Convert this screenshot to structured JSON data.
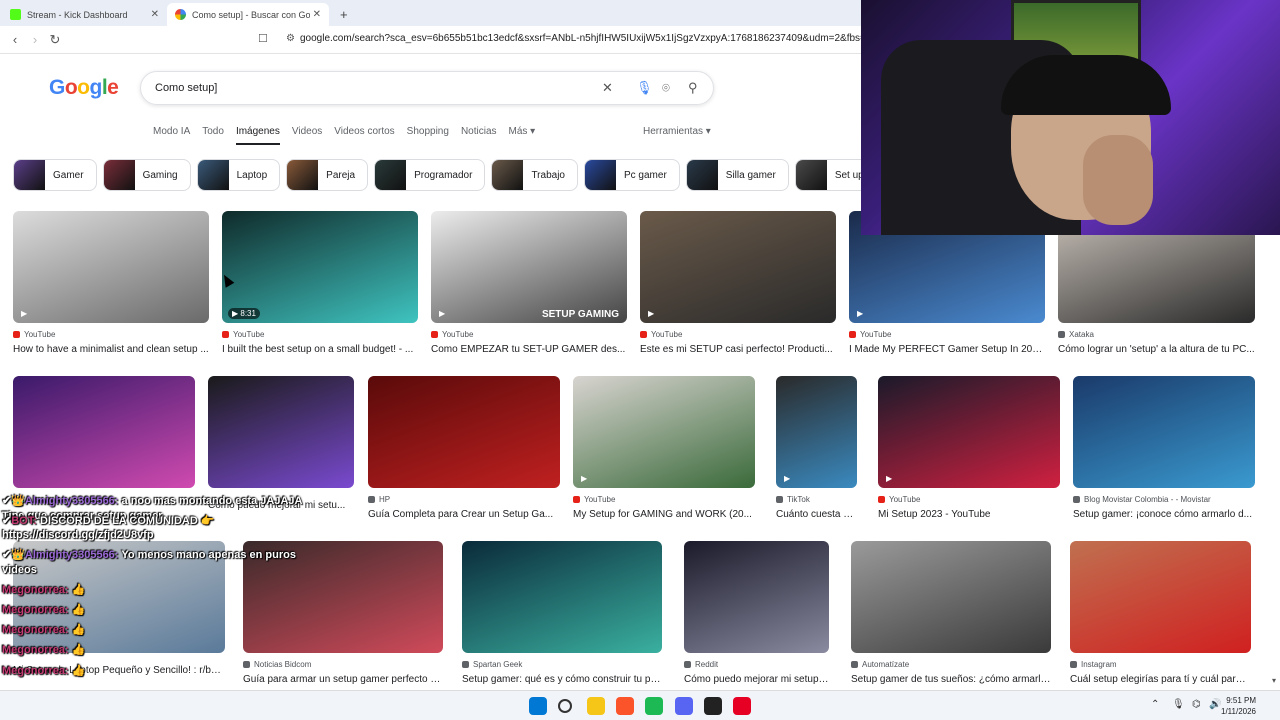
{
  "browser": {
    "tabs": [
      {
        "title": "Stream - Kick Dashboard"
      },
      {
        "title": "Como setup] - Buscar con Goog"
      }
    ],
    "new_tab": "+",
    "url": "google.com/search?sca_esv=6b655b51bc13edcf&sxsrf=ANbL-n5hjfIHW5IUxijW5x1IjSgzVzxpyA:1768186237409&udm=2&fbs=ADc_l-b"
  },
  "google": {
    "logo_letters": [
      "G",
      "o",
      "o",
      "g",
      "l",
      "e"
    ],
    "query": "Como setup]",
    "tabs": [
      "Modo IA",
      "Todo",
      "Imágenes",
      "Videos",
      "Videos cortos",
      "Shopping",
      "Noticias",
      "Más ▾"
    ],
    "active_tab": "Imágenes",
    "tools": "Herramientas ▾",
    "chips": [
      {
        "label": "Gamer",
        "color": "#5b3f8a"
      },
      {
        "label": "Gaming",
        "color": "#7a2e3a"
      },
      {
        "label": "Laptop",
        "color": "#3a5a7a"
      },
      {
        "label": "Pareja",
        "color": "#8a5a3a"
      },
      {
        "label": "Programador",
        "color": "#2a3a3a"
      },
      {
        "label": "Trabajo",
        "color": "#6a5a4a"
      },
      {
        "label": "Pc gamer",
        "color": "#2a4aa0"
      },
      {
        "label": "Silla gamer",
        "color": "#2a3a4a"
      },
      {
        "label": "Set up gamer b",
        "color": "#4a4a4a"
      }
    ]
  },
  "results_row1": [
    {
      "source": "YouTube",
      "title": "How to have a minimalist and clean setup ...",
      "colors": [
        "#dcdcdc",
        "#6a6a6a"
      ]
    },
    {
      "source": "YouTube",
      "title": "I built the best setup on a small budget! - ...",
      "colors": [
        "#0f2a2a",
        "#3fc4c0"
      ],
      "duration": "▶ 8:31"
    },
    {
      "source": "YouTube",
      "title": "Como EMPEZAR tu SET-UP GAMER des...",
      "colors": [
        "#ececec",
        "#444"
      ],
      "overlay": "SETUP GAMING"
    },
    {
      "source": "YouTube",
      "title": "Este es mi SETUP casi perfecto! Producti...",
      "colors": [
        "#6a5a4a",
        "#2a2a2a"
      ]
    },
    {
      "source": "YouTube",
      "title": "I Made My PERFECT Gamer Setup In 202...",
      "colors": [
        "#1a2a4a",
        "#4a8ad0"
      ]
    },
    {
      "source": "Xataka",
      "title": "Cómo lograr un 'setup' a la altura de tu PC...",
      "colors": [
        "#c8c0b8",
        "#2a2a2a"
      ]
    }
  ],
  "results_row2": [
    {
      "source": "",
      "title": "",
      "colors": [
        "#3a1a6a",
        "#d04ab0"
      ]
    },
    {
      "source": "",
      "title": "Cómo puedo mejorar mi setu...",
      "colors": [
        "#1a1a1a",
        "#7a4ad0"
      ]
    },
    {
      "source": "HP",
      "title": "Guía Completa para Crear un Setup Ga...",
      "colors": [
        "#5a0a0a",
        "#c02020"
      ]
    },
    {
      "source": "YouTube",
      "title": "My Setup for GAMING and WORK (20...",
      "colors": [
        "#d8d4d0",
        "#3a6a3a"
      ]
    },
    {
      "source": "TikTok",
      "title": "Cuánto cuesta mi ...",
      "colors": [
        "#2a2a2a",
        "#3a8ac0"
      ]
    },
    {
      "source": "YouTube",
      "title": "Mi Setup 2023 - YouTube",
      "colors": [
        "#1a1a2a",
        "#d02040"
      ]
    },
    {
      "source": "Blog Movistar Colombia - - Movistar",
      "title": "Setup gamer: ¡conoce cómo armarlo d...",
      "colors": [
        "#1a3a6a",
        "#3a9ad0"
      ]
    }
  ],
  "results_row3": [
    {
      "source": "",
      "title": "Mi Setup de Laptop Pequeño y Sencillo! : r/bat...",
      "colors": [
        "#c8c8c8",
        "#5a7a9a"
      ]
    },
    {
      "source": "Noticias Bidcom",
      "title": "Guía para armar un setup gamer perfecto - ...",
      "colors": [
        "#3a2a2a",
        "#d04a5a"
      ]
    },
    {
      "source": "Spartan Geek",
      "title": "Setup gamer: qué es y cómo construir tu pro...",
      "colors": [
        "#0a2a3a",
        "#3ab0a0"
      ]
    },
    {
      "source": "Reddit",
      "title": "Cómo puedo mejorar mi setup g...",
      "colors": [
        "#1a1a2a",
        "#8a8aa0"
      ]
    },
    {
      "source": "Automatízate",
      "title": "Setup gamer de tus sueños: ¿cómo armarlo?",
      "colors": [
        "#9a9a9a",
        "#3a3a3a"
      ]
    },
    {
      "source": "Instagram",
      "title": "Cuál setup elegirías para tí y cuál para t...",
      "colors": [
        "#c07050",
        "#d02020"
      ]
    }
  ],
  "chat": [
    {
      "prefix": "✔👑",
      "name": "Almighty3305566:",
      "text": " a noo mas montando esta JAJAJA"
    },
    {
      "prefix": "",
      "name": "",
      "text": "Tine que comprar setup gamer"
    },
    {
      "prefix": "✔",
      "name": "BOT:",
      "text": " DISCORD DE LA COMUNIDAD 👉"
    },
    {
      "prefix": "",
      "name": "",
      "text": "https://discord.gg/zfjd2U8vfp"
    },
    {
      "prefix": "✔👑",
      "name": "Almighty3305566:",
      "text": " Yo menos mano apenas en puros"
    },
    {
      "prefix": "",
      "name": "",
      "text": "videos"
    },
    {
      "prefix": "",
      "name": "Megonorrea:",
      "text": " 👍"
    },
    {
      "prefix": "",
      "name": "Megonorrea:",
      "text": " 👍"
    },
    {
      "prefix": "",
      "name": "Megonorrea:",
      "text": " 👍"
    },
    {
      "prefix": "",
      "name": "Megonorrea:",
      "text": " 👍"
    },
    {
      "prefix": "",
      "name": "Megonorrea:",
      "text": " 👍"
    }
  ],
  "taskbar": {
    "time": "9:51 PM",
    "date": "1/11/2026",
    "apps": [
      "#0078d4",
      "#333",
      "#f5c518",
      "#fb542b",
      "#1db954",
      "#5865f2",
      "#222",
      "#e60023"
    ]
  }
}
